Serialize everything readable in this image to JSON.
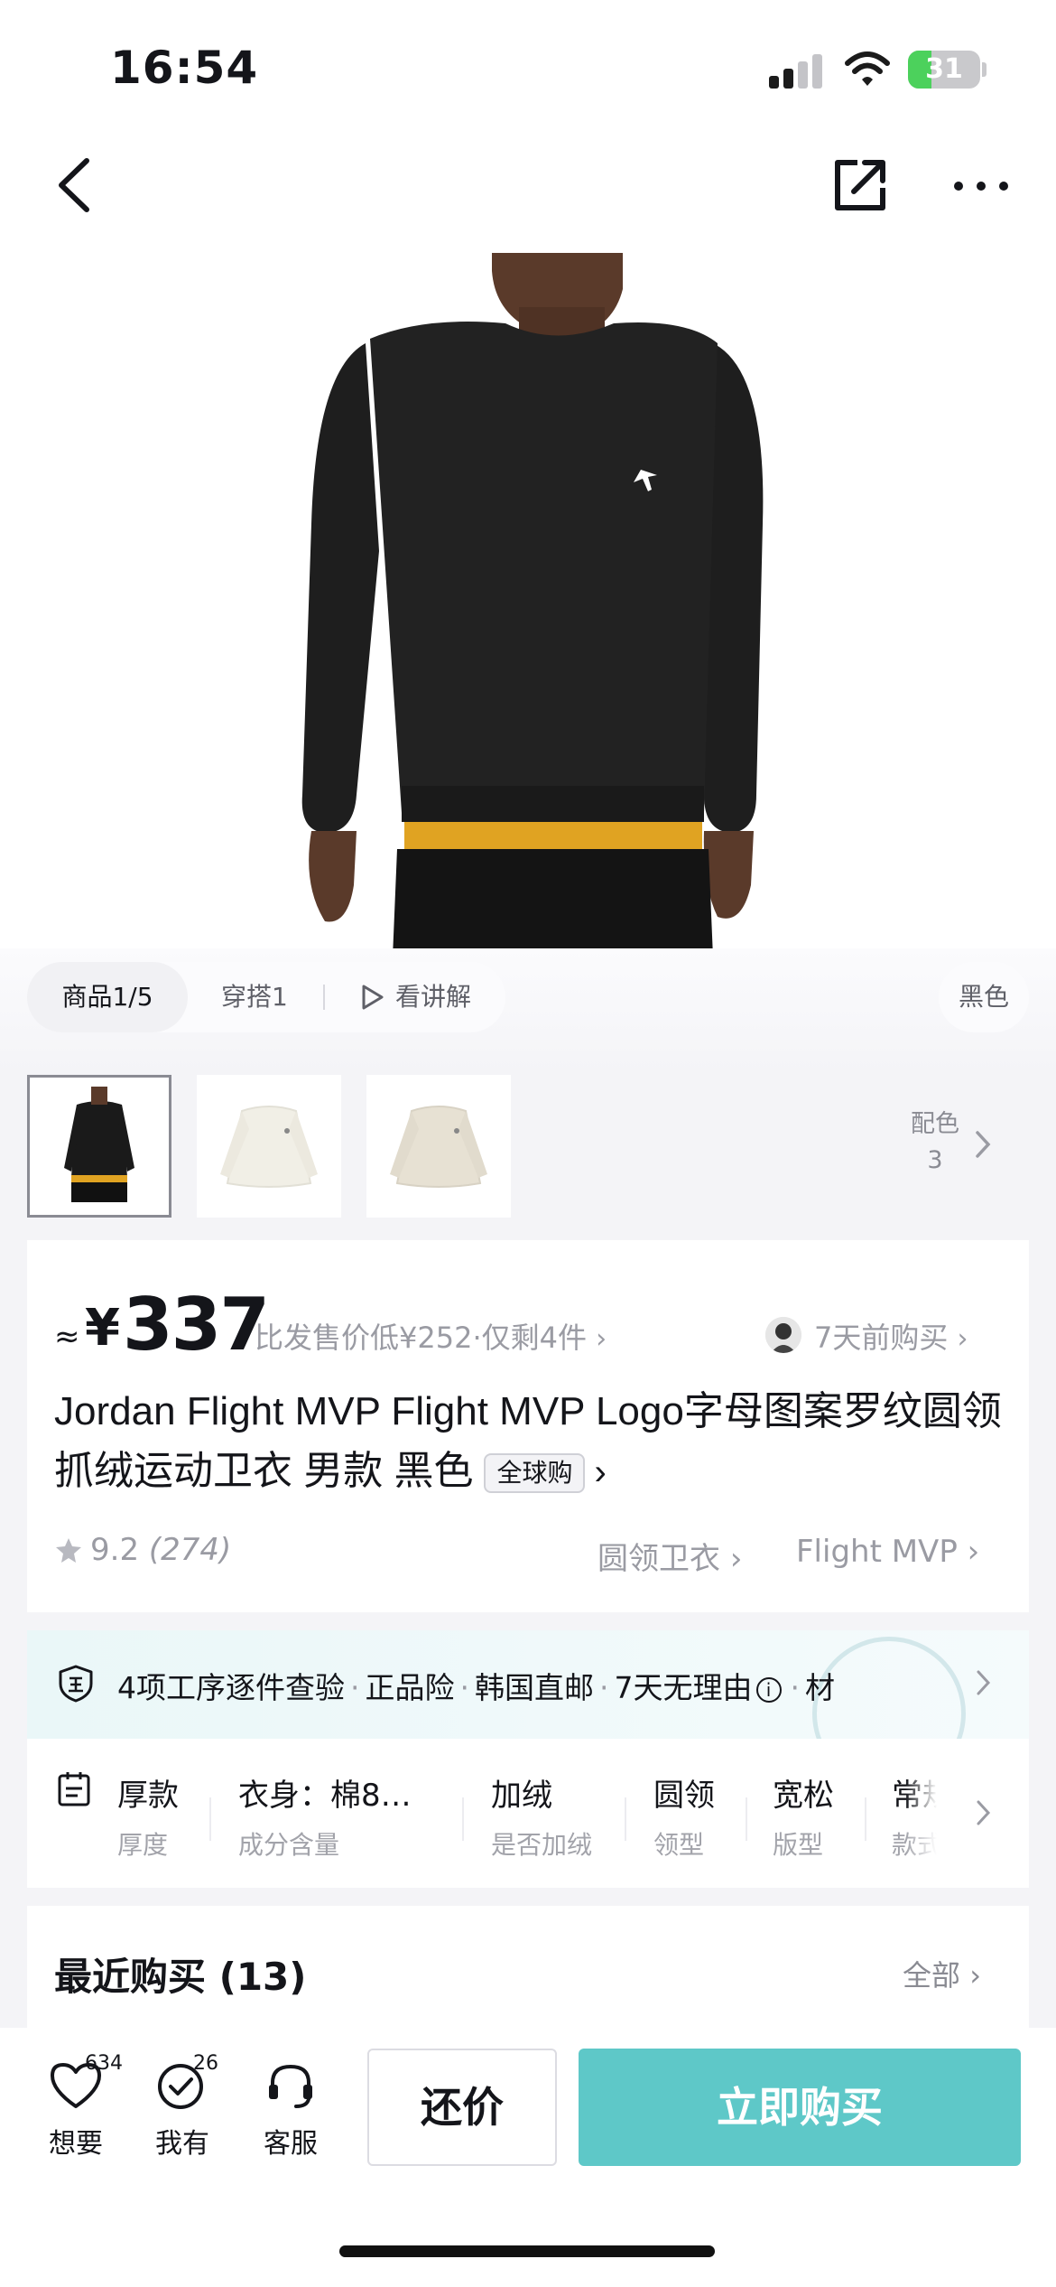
{
  "status_bar": {
    "time": "16:54",
    "battery": "31"
  },
  "media": {
    "tabs": [
      {
        "label": "商品1/5"
      },
      {
        "label": "穿搭1"
      },
      {
        "label": "看讲解"
      }
    ],
    "color_label": "黑色"
  },
  "thumbnails": {
    "items": [
      {
        "color": "#1a1a1a"
      },
      {
        "color": "#f4f2ea"
      },
      {
        "color": "#e9e4d8"
      }
    ],
    "more_label": "配色",
    "more_count": "3"
  },
  "product": {
    "approx": "≈",
    "currency": "¥",
    "price": "337",
    "price_note": "比发售价低¥252·仅剩4件",
    "recent_buyer": "7天前购买",
    "title": "Jordan Flight MVP Flight MVP Logo字母图案罗纹圆领抓绒运动卫衣 男款 黑色",
    "tag": "全球购",
    "rating": "9.2",
    "rating_count": "(274)",
    "category_link": "圆领卫衣",
    "series_link": "Flight MVP"
  },
  "guarantee": {
    "items": [
      "4项工序逐件查验",
      "正品险",
      "韩国直邮",
      "7天无理由",
      "材"
    ]
  },
  "attributes": [
    {
      "value": "厚款",
      "key": "厚度"
    },
    {
      "value": "衣身：棉8…",
      "key": "成分含量"
    },
    {
      "value": "加绒",
      "key": "是否加绒"
    },
    {
      "value": "圆领",
      "key": "领型"
    },
    {
      "value": "宽松",
      "key": "版型"
    },
    {
      "value": "常规",
      "key": "款式"
    }
  ],
  "recent": {
    "title": "最近购买 (13)",
    "all_label": "全部"
  },
  "bottom_bar": {
    "want_label": "想要",
    "want_count": "634",
    "own_label": "我有",
    "own_count": "26",
    "service_label": "客服",
    "bargain_label": "还价",
    "buy_label": "立即购买"
  }
}
